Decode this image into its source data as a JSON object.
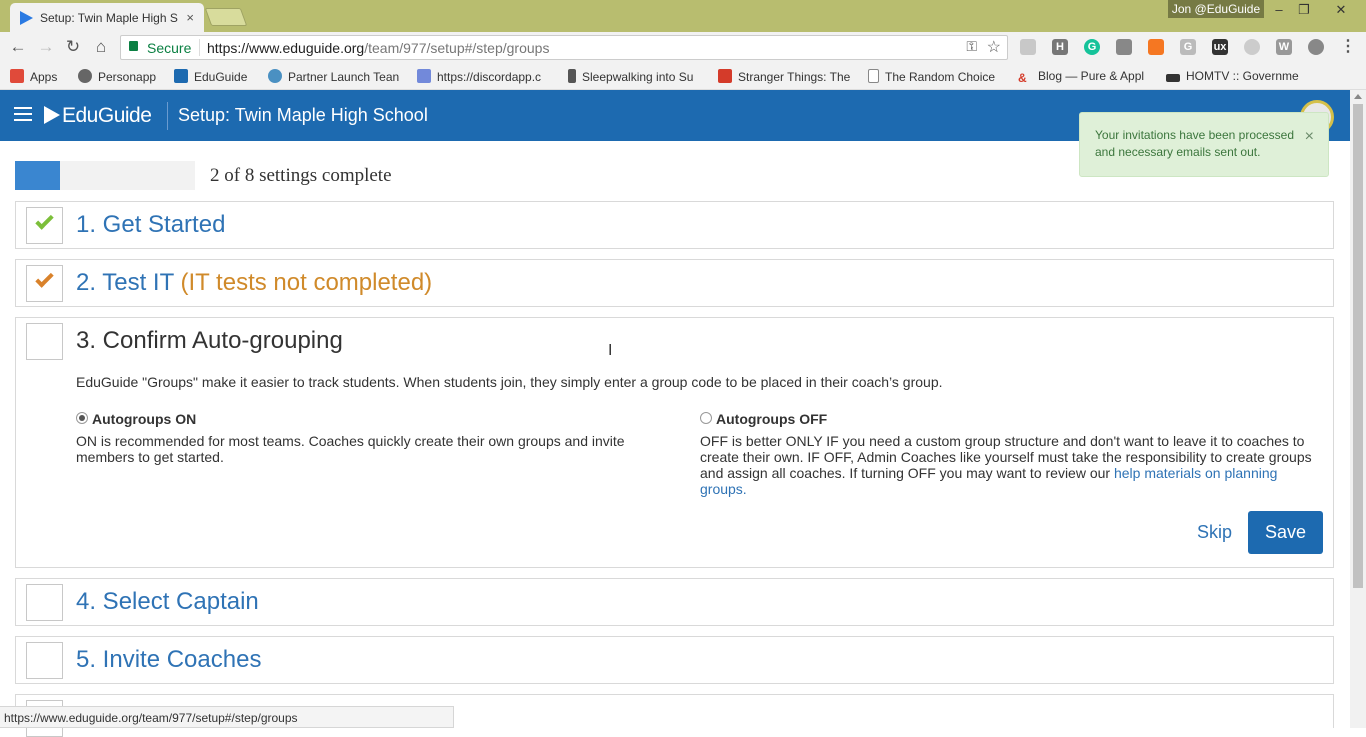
{
  "browser": {
    "tab_title": "Setup: Twin Maple High S",
    "tab_close": "×",
    "user_label": "Jon @EduGuide",
    "window_controls": [
      "–",
      "❐",
      "✕"
    ],
    "secure_label": "Secure",
    "url_host": "https://www.eduguide.org",
    "url_path": "/team/977/setup#/step/groups",
    "bookmarks": [
      {
        "label": "Apps",
        "icon": "apps-grid-icon",
        "color": "#e04a3a"
      },
      {
        "label": "Personapp",
        "icon": "personapp-icon",
        "color": "#666666"
      },
      {
        "label": "EduGuide",
        "icon": "eduguide-icon",
        "color": "#1d6ab0"
      },
      {
        "label": "Partner Launch Tean",
        "icon": "location-pin-icon",
        "color": "#4a90c2"
      },
      {
        "label": "https://discordapp.c",
        "icon": "discord-icon",
        "color": "#7289da"
      },
      {
        "label": "Sleepwalking into Su",
        "icon": "bookmark-icon",
        "color": "#555555"
      },
      {
        "label": "Stranger Things: The",
        "icon": "stranger-things-icon",
        "color": "#d43b2a"
      },
      {
        "label": "The Random Choice",
        "icon": "page-icon",
        "color": "#888888"
      },
      {
        "label": "Blog — Pure & Appl",
        "icon": "ampersand-icon",
        "color": "#d43b2a"
      },
      {
        "label": "HOMTV :: Governme",
        "icon": "homtv-icon",
        "color": "#333333"
      }
    ],
    "status_url": "https://www.eduguide.org/team/977/setup#/step/groups"
  },
  "app": {
    "logo_text": "EduGuide",
    "page_title": "Setup: Twin Maple High School"
  },
  "toast": {
    "message_line1": "Your invitations have been processed",
    "message_line2": "and necessary emails sent out.",
    "close": "×"
  },
  "progress": {
    "text": "2 of 8 settings complete",
    "completed": 2,
    "total": 8
  },
  "steps": [
    {
      "title": "1. Get Started",
      "status": "complete",
      "check_color": "#7cbf3a"
    },
    {
      "title": "2. Test IT",
      "warning": "(IT tests not completed)",
      "status": "warning",
      "check_color": "#d9822b"
    },
    {
      "title": "3. Confirm Auto-grouping",
      "status": "active",
      "description": "EduGuide \"Groups\" make it easier to track students. When students join, they simply enter a group code to be placed in their coach’s group.",
      "options": [
        {
          "label": "Autogroups ON",
          "selected": true,
          "text": "ON is recommended for most teams. Coaches quickly create their own groups and invite members to get started."
        },
        {
          "label": "Autogroups OFF",
          "selected": false,
          "text": "OFF is better ONLY IF you need a custom group structure and don't want to leave it to coaches to create their own. IF OFF, Admin Coaches like yourself must take the responsibility to create groups and assign all coaches. If turning OFF you may want to review our ",
          "link": "help materials on planning groups."
        }
      ],
      "skip_label": "Skip",
      "save_label": "Save"
    },
    {
      "title": "4. Select Captain",
      "status": "incomplete"
    },
    {
      "title": "5. Invite Coaches",
      "status": "incomplete"
    }
  ]
}
